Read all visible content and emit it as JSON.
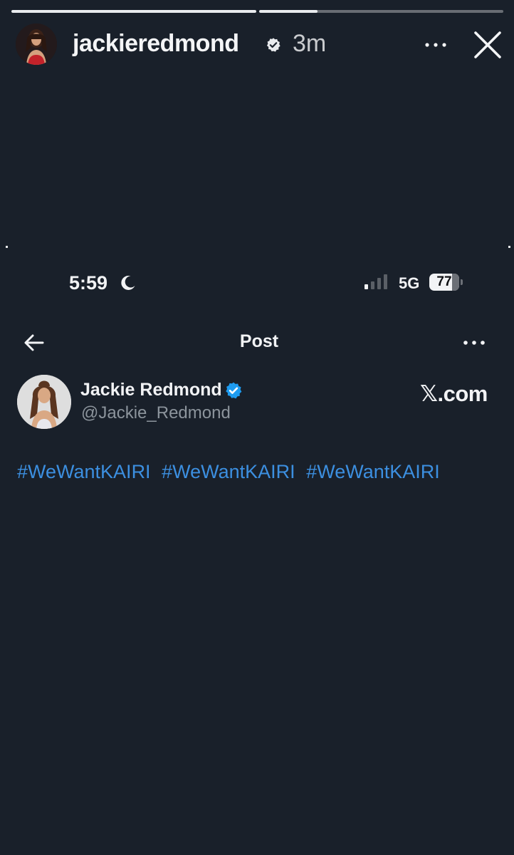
{
  "story": {
    "progress": [
      1.0,
      0.24
    ],
    "username": "jackieredmond",
    "time_ago": "3m",
    "icons": {
      "verified": "verified-badge-icon",
      "more": "more-horizontal-icon",
      "close": "close-icon"
    }
  },
  "screenshot": {
    "status_bar": {
      "time": "5:59",
      "network": "5G",
      "battery": "77",
      "battery_level": 0.77,
      "icons": {
        "moon": "moon-icon",
        "signal": "signal-icon"
      }
    },
    "nav": {
      "title": "Post",
      "icons": {
        "back": "back-arrow-icon",
        "more": "more-horizontal-icon"
      }
    },
    "author": {
      "name": "Jackie Redmond",
      "handle": "@Jackie_Redmond",
      "source": "𝕏.com"
    },
    "hashtags": [
      "#WeWantKAIRI",
      "#WeWantKAIRI",
      "#WeWantKAIRI"
    ]
  },
  "colors": {
    "background": "#19202a",
    "hashtag": "#3c8fe0",
    "x_verified": "#1d9bf0"
  }
}
